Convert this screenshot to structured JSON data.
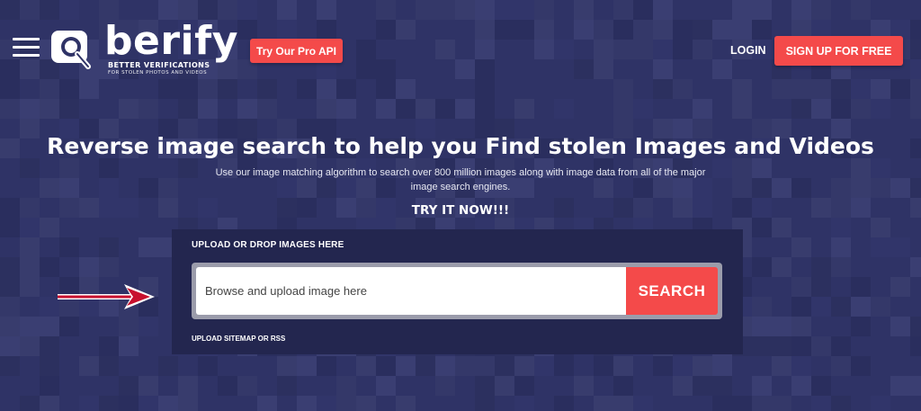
{
  "header": {
    "menu_icon": "hamburger-menu-icon",
    "logo": {
      "icon": "magnifier-logo-icon",
      "word": "berify",
      "tagline": "BETTER VERIFICATIONS",
      "subtagline": "FOR STOLEN PHOTOS AND VIDEOS"
    },
    "pro_api_label": "Try Our Pro API",
    "login_label": "LOGIN",
    "signup_label": "SIGN UP FOR FREE"
  },
  "hero": {
    "title": "Reverse image search to help you Find stolen Images and Videos",
    "subtitle": "Use our image matching algorithm to search over 800 million images along with image data from all of the major image search engines.",
    "cta": "TRY IT NOW!!!"
  },
  "upload": {
    "label": "UPLOAD OR DROP IMAGES HERE",
    "input_placeholder": "Browse and upload image here",
    "search_label": "SEARCH",
    "sitemap_label": "UPLOAD SITEMAP OR RSS"
  },
  "annotation": {
    "arrow_icon": "red-arrow-icon"
  },
  "colors": {
    "background": "#2f3366",
    "panel": "#23264f",
    "accent_red": "#f44a4a",
    "arrow_red": "#c8102e"
  }
}
